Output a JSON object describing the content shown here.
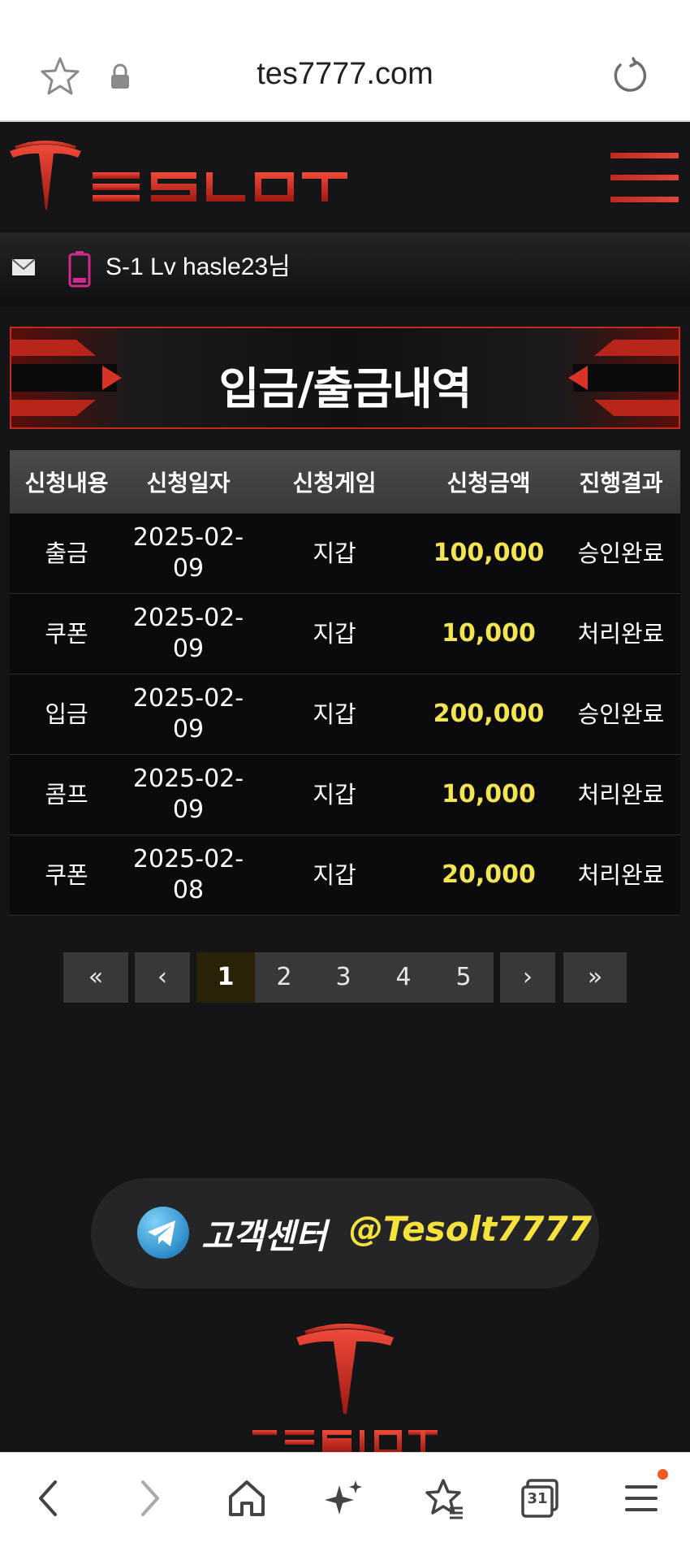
{
  "browser": {
    "url": "tes7777.com"
  },
  "header": {
    "logo_text": "TESLOT"
  },
  "user": {
    "text": "S-1 Lv hasle23님"
  },
  "page": {
    "title": "입금/출금내역"
  },
  "table": {
    "headers": [
      "신청내용",
      "신청일자",
      "신청게임",
      "신청금액",
      "진행결과"
    ],
    "rows": [
      {
        "type": "출금",
        "date_line1": "2025-02-",
        "date_line2": "09",
        "game": "지갑",
        "amount": "100,000",
        "status": "승인완료"
      },
      {
        "type": "쿠폰",
        "date_line1": "2025-02-",
        "date_line2": "09",
        "game": "지갑",
        "amount": "10,000",
        "status": "처리완료"
      },
      {
        "type": "입금",
        "date_line1": "2025-02-",
        "date_line2": "09",
        "game": "지갑",
        "amount": "200,000",
        "status": "승인완료"
      },
      {
        "type": "콤프",
        "date_line1": "2025-02-",
        "date_line2": "09",
        "game": "지갑",
        "amount": "10,000",
        "status": "처리완료"
      },
      {
        "type": "쿠폰",
        "date_line1": "2025-02-",
        "date_line2": "08",
        "game": "지갑",
        "amount": "20,000",
        "status": "처리완료"
      }
    ]
  },
  "pagination": {
    "first": "«",
    "prev": "‹",
    "pages": [
      "1",
      "2",
      "3",
      "4",
      "5"
    ],
    "current": "1",
    "next": "›",
    "last": "»"
  },
  "support": {
    "label": "고객센터",
    "handle": "@Tesolt7777"
  },
  "colors": {
    "brand_red": "#d4281c",
    "amount_yellow": "#f3e552",
    "handle_yellow": "#f6e23c",
    "background": "#151416"
  },
  "icons": [
    "star-icon",
    "lock-icon",
    "reload-icon",
    "menu-icon",
    "mail-icon",
    "battery-icon",
    "telegram-icon",
    "back-icon",
    "forward-icon",
    "home-icon",
    "sparkle-icon",
    "bookmarks-icon",
    "tabs-icon",
    "browser-menu-icon"
  ],
  "bottom_nav": {
    "tabs_count": "31"
  }
}
